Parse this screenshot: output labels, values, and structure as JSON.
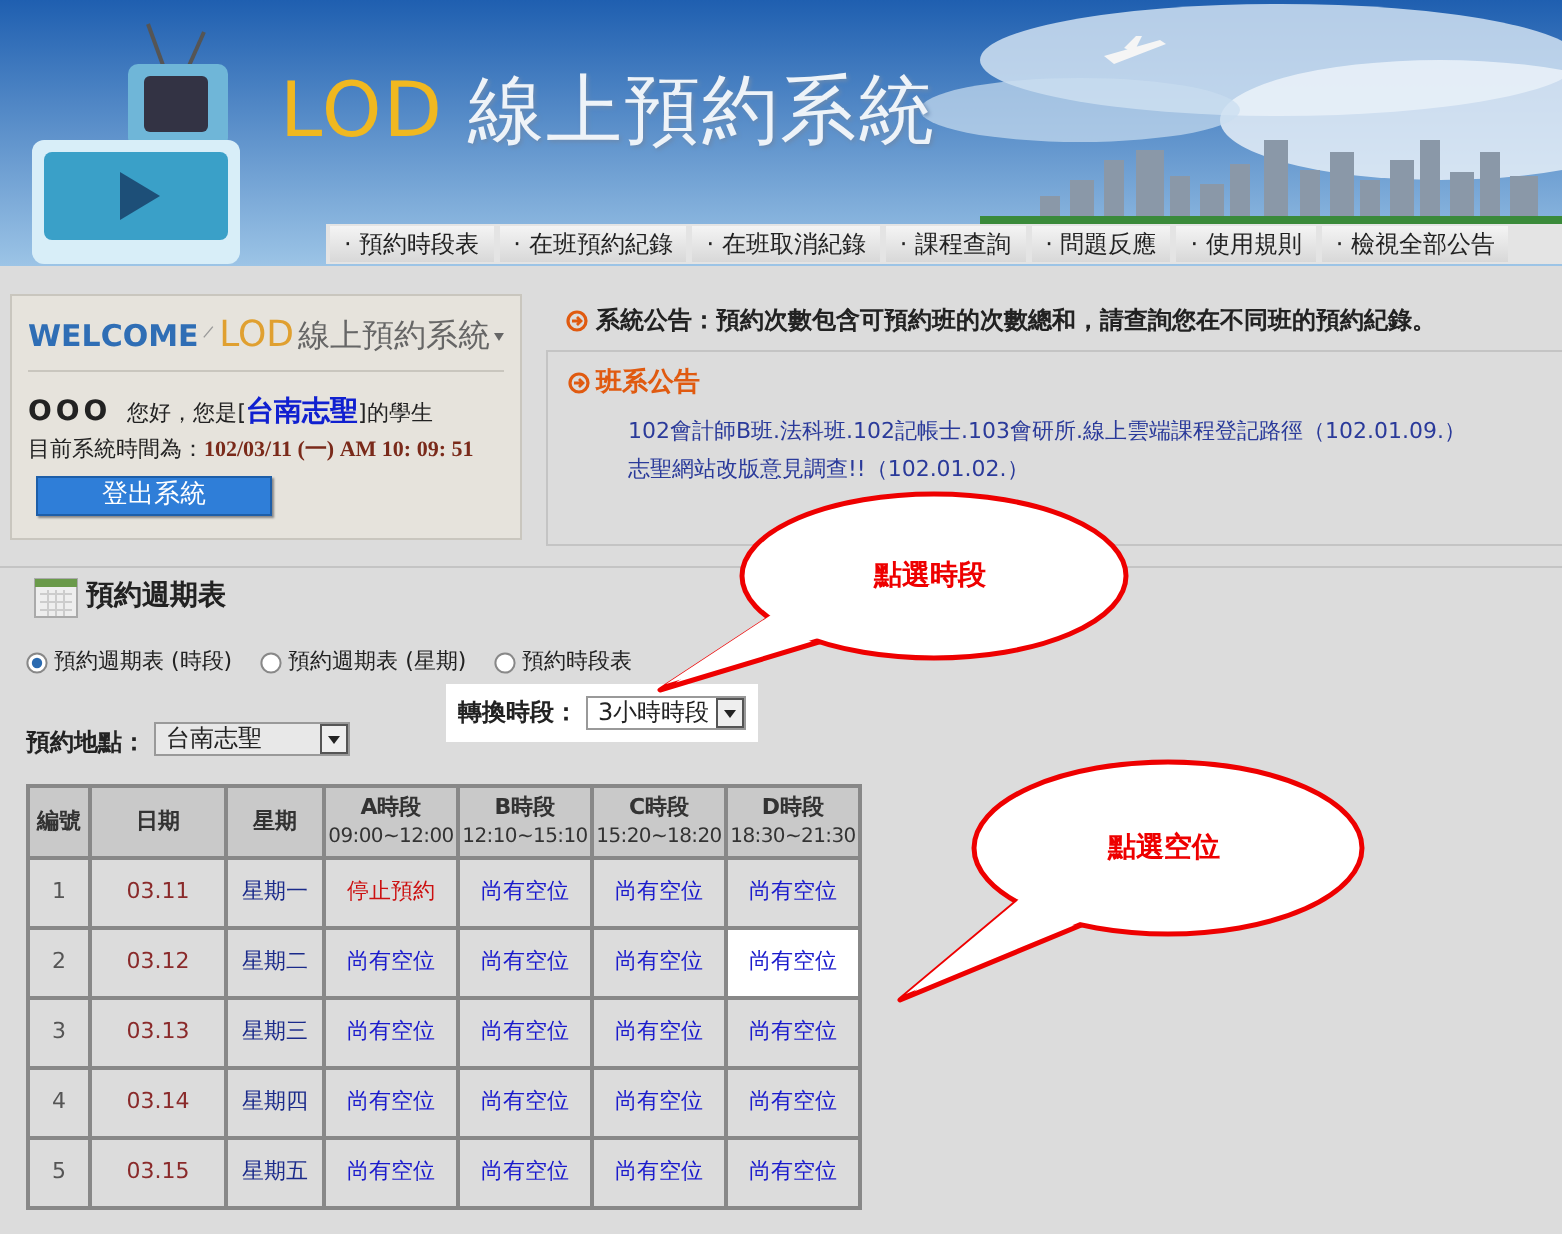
{
  "header": {
    "logo_latin": "LOD",
    "logo_title": "線上預約系統"
  },
  "nav": [
    {
      "label": "· 預約時段表"
    },
    {
      "label": "· 在班預約紀錄"
    },
    {
      "label": "· 在班取消紀錄"
    },
    {
      "label": "· 課程查詢"
    },
    {
      "label": "· 問題反應"
    },
    {
      "label": "· 使用規則"
    },
    {
      "label": "· 檢視全部公告"
    }
  ],
  "welcome": {
    "welcome": "WELCOME",
    "brand": "LOD",
    "title": "線上預約系統",
    "user": "OOO",
    "greeting_before": "您好，您是[",
    "school": "台南志聖",
    "greeting_after": "]的學生",
    "time_label": "目前系統時間為：",
    "time": "102/03/11 (一) AM 10: 09: 51",
    "logout": "登出系統"
  },
  "system_notice": "系統公告：預約次數包含可預約班的次數總和，請查詢您在不同班的預約紀錄。",
  "class_notices": {
    "title": "班系公告",
    "items": [
      "102會計師B班.法科班.102記帳士.103會研所.線上雲端課程登記路徑（102.01.09.）",
      "志聖網站改版意見調查!!（102.01.02.）"
    ]
  },
  "schedule": {
    "title": "預約週期表",
    "radios": [
      {
        "label": "預約週期表 (時段)",
        "selected": true
      },
      {
        "label": "預約週期表 (星期)",
        "selected": false
      },
      {
        "label": "預約時段表",
        "selected": false
      }
    ],
    "location_label": "預約地點：",
    "location": "台南志聖",
    "switch_label": "轉換時段：",
    "switch_value": "3小時時段",
    "columns": [
      {
        "title": "編號"
      },
      {
        "title": "日期"
      },
      {
        "title": "星期"
      },
      {
        "title": "A時段",
        "sub": "09:00~12:00"
      },
      {
        "title": "B時段",
        "sub": "12:10~15:10"
      },
      {
        "title": "C時段",
        "sub": "15:20~18:20"
      },
      {
        "title": "D時段",
        "sub": "18:30~21:30"
      }
    ],
    "rows": [
      {
        "no": "1",
        "date": "03.11",
        "weekday": "星期一",
        "slots": [
          {
            "text": "停止預約",
            "kind": "closed",
            "selected": false
          },
          {
            "text": "尚有空位",
            "kind": "open",
            "selected": false
          },
          {
            "text": "尚有空位",
            "kind": "open",
            "selected": false
          },
          {
            "text": "尚有空位",
            "kind": "open",
            "selected": false
          }
        ]
      },
      {
        "no": "2",
        "date": "03.12",
        "weekday": "星期二",
        "slots": [
          {
            "text": "尚有空位",
            "kind": "open",
            "selected": false
          },
          {
            "text": "尚有空位",
            "kind": "open",
            "selected": false
          },
          {
            "text": "尚有空位",
            "kind": "open",
            "selected": false
          },
          {
            "text": "尚有空位",
            "kind": "open",
            "selected": true
          }
        ]
      },
      {
        "no": "3",
        "date": "03.13",
        "weekday": "星期三",
        "slots": [
          {
            "text": "尚有空位",
            "kind": "open",
            "selected": false
          },
          {
            "text": "尚有空位",
            "kind": "open",
            "selected": false
          },
          {
            "text": "尚有空位",
            "kind": "open",
            "selected": false
          },
          {
            "text": "尚有空位",
            "kind": "open",
            "selected": false
          }
        ]
      },
      {
        "no": "4",
        "date": "03.14",
        "weekday": "星期四",
        "slots": [
          {
            "text": "尚有空位",
            "kind": "open",
            "selected": false
          },
          {
            "text": "尚有空位",
            "kind": "open",
            "selected": false
          },
          {
            "text": "尚有空位",
            "kind": "open",
            "selected": false
          },
          {
            "text": "尚有空位",
            "kind": "open",
            "selected": false
          }
        ]
      },
      {
        "no": "5",
        "date": "03.15",
        "weekday": "星期五",
        "slots": [
          {
            "text": "尚有空位",
            "kind": "open",
            "selected": false
          },
          {
            "text": "尚有空位",
            "kind": "open",
            "selected": false
          },
          {
            "text": "尚有空位",
            "kind": "open",
            "selected": false
          },
          {
            "text": "尚有空位",
            "kind": "open",
            "selected": false
          }
        ]
      }
    ]
  },
  "callouts": [
    {
      "text": "點選時段"
    },
    {
      "text": "點選空位"
    }
  ]
}
